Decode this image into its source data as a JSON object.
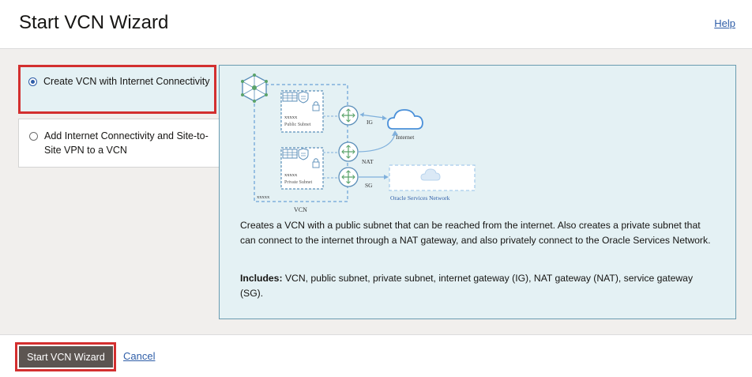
{
  "header": {
    "title": "Start VCN Wizard",
    "help_label": "Help"
  },
  "options": [
    {
      "label": "Create VCN with Internet Connectivity",
      "selected": true
    },
    {
      "label": "Add Internet Connectivity and Site-to-Site VPN to a VCN",
      "selected": false
    }
  ],
  "diagram": {
    "public_subnet_label": "Public Subnet",
    "private_subnet_label": "Private Subnet",
    "subnet_cidr": "xxxxx",
    "vcn_cidr": "xxxxx",
    "vcn_label": "VCN",
    "ig_label": "IG",
    "nat_label": "NAT",
    "sg_label": "SG",
    "internet_label": "Internet",
    "oracle_services_label": "Oracle Services Network"
  },
  "panel": {
    "description": "Creates a VCN with a public subnet that can be reached from the internet. Also creates a private subnet that can connect to the internet through a NAT gateway, and also privately connect to the Oracle Services Network.",
    "includes_label": "Includes:",
    "includes_text": " VCN, public subnet, private subnet, internet gateway (IG), NAT gateway (NAT), service gateway (SG)."
  },
  "footer": {
    "primary_label": "Start VCN Wizard",
    "cancel_label": "Cancel"
  },
  "colors": {
    "accent": "#2f5ea8",
    "highlight": "#d32f2f",
    "panel_bg": "#e4f1f4",
    "button_bg": "#5c5551"
  }
}
